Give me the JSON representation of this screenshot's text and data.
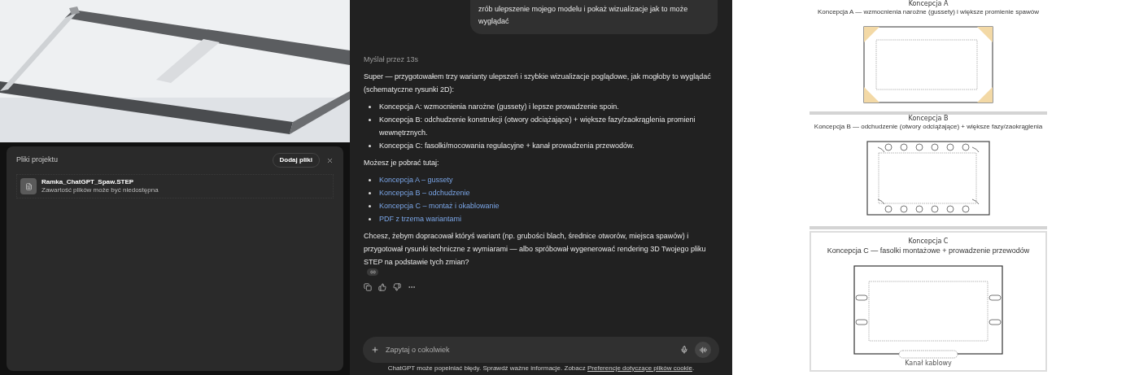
{
  "project_files": {
    "title": "Pliki projektu",
    "add_button": "Dodaj pliki",
    "files": [
      {
        "name": "Ramka_ChatGPT_Spaw.STEP",
        "note": "Zawartość plików może być niedostępna"
      }
    ]
  },
  "chat": {
    "user_message": "zrób ulepszenie mojego modelu i pokaż wizualizacje jak to może wyglądać",
    "thinking": "Myślał przez 13s",
    "intro": "Super — przygotowałem trzy warianty ulepszeń i szybkie wizualizacje poglądowe, jak mogłoby to wyglądać (schematyczne rysunki 2D):",
    "bullets": [
      "Koncepcja A: wzmocnienia narożne (gussety) i lepsze prowadzenie spoin.",
      "Koncepcja B: odchudzenie konstrukcji (otwory odciążające) + większe fazy/zaokrąglenia promieni wewnętrznych.",
      "Koncepcja C: fasolki/mocowania regulacyjne + kanał prowadzenia przewodów."
    ],
    "download_label": "Możesz je pobrać tutaj:",
    "links": [
      "Koncepcja A – gussety",
      "Koncepcja B – odchudzenie",
      "Koncepcja C – montaż i okablowanie",
      "PDF z trzema wariantami"
    ],
    "closing": "Chcesz, żebym dopracował któryś wariant (np. grubości blach, średnice otworów, miejsca spawów) i przygotował rysunki techniczne z wymiarami — albo spróbował wygenerować rendering 3D Twojego pliku STEP na podstawie tych zmian?",
    "input_placeholder": "Zapytaj o cokolwiek",
    "disclaimer": "ChatGPT może popełniać błędy. Sprawdź ważne informacje. Zobacz",
    "disclaimer_link": "Preferencje dotyczące plików cookie",
    "disclaimer_end": "."
  },
  "figures": [
    {
      "kind": "gussets",
      "caption": "Koncepcja A",
      "title": "Koncepcja A — wzmocnienia narożne (gussety) i większe promienie spawów"
    },
    {
      "kind": "holes",
      "caption": "Koncepcja B",
      "title": "Koncepcja B — odchudzenie (otwory odciążające) + większe fazy/zaokrąglenia"
    },
    {
      "kind": "slots",
      "caption": "Koncepcja C",
      "title": "Koncepcja C — fasolki montażowe + prowadzenie przewodów",
      "channel_label": "Kanał kablowy"
    }
  ]
}
